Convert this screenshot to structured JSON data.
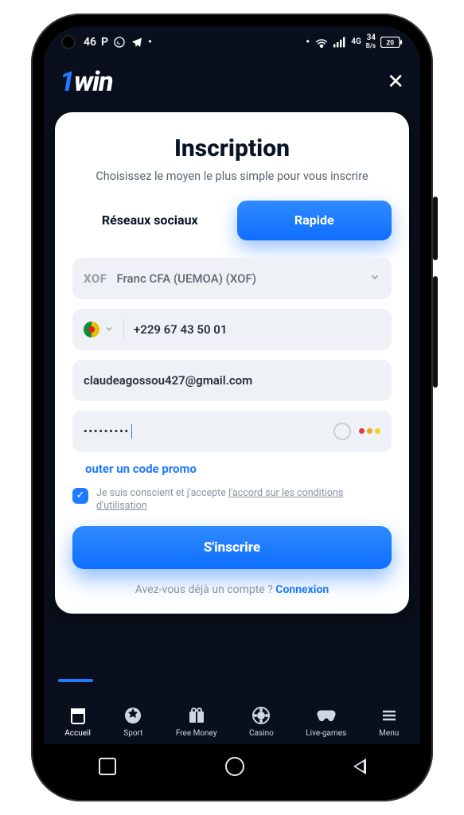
{
  "status": {
    "time_prefix": "46",
    "time_letter": "P",
    "net_label": "4G",
    "speed": "34",
    "speed_unit": "B/s",
    "battery": "20"
  },
  "header": {
    "close_glyph": "✕"
  },
  "card": {
    "title": "Inscription",
    "subtitle": "Choisissez le moyen le plus simple pour vous inscrire",
    "tab_social": "Réseaux sociaux",
    "tab_quick": "Rapide",
    "currency_prefix": "XOF",
    "currency_label": "Franc CFA (UEMOA) (XOF)",
    "phone_value": "+229 67 43 50 01",
    "email_value": "claudeagossou427@gmail.com",
    "password_mask": "•••••••••",
    "promo_label": "outer un code promo",
    "consent_prefix": "Je suis conscient et j'accepte ",
    "consent_link": "l'accord sur les conditions d'utilisation",
    "cta": "S'inscrire",
    "already": "Avez-vous déjà un compte ? ",
    "login": "Connexion"
  },
  "tabs": {
    "home": "Accueil",
    "sport": "Sport",
    "free": "Free Money",
    "casino": "Casino",
    "live": "Live-games",
    "menu": "Menu"
  }
}
